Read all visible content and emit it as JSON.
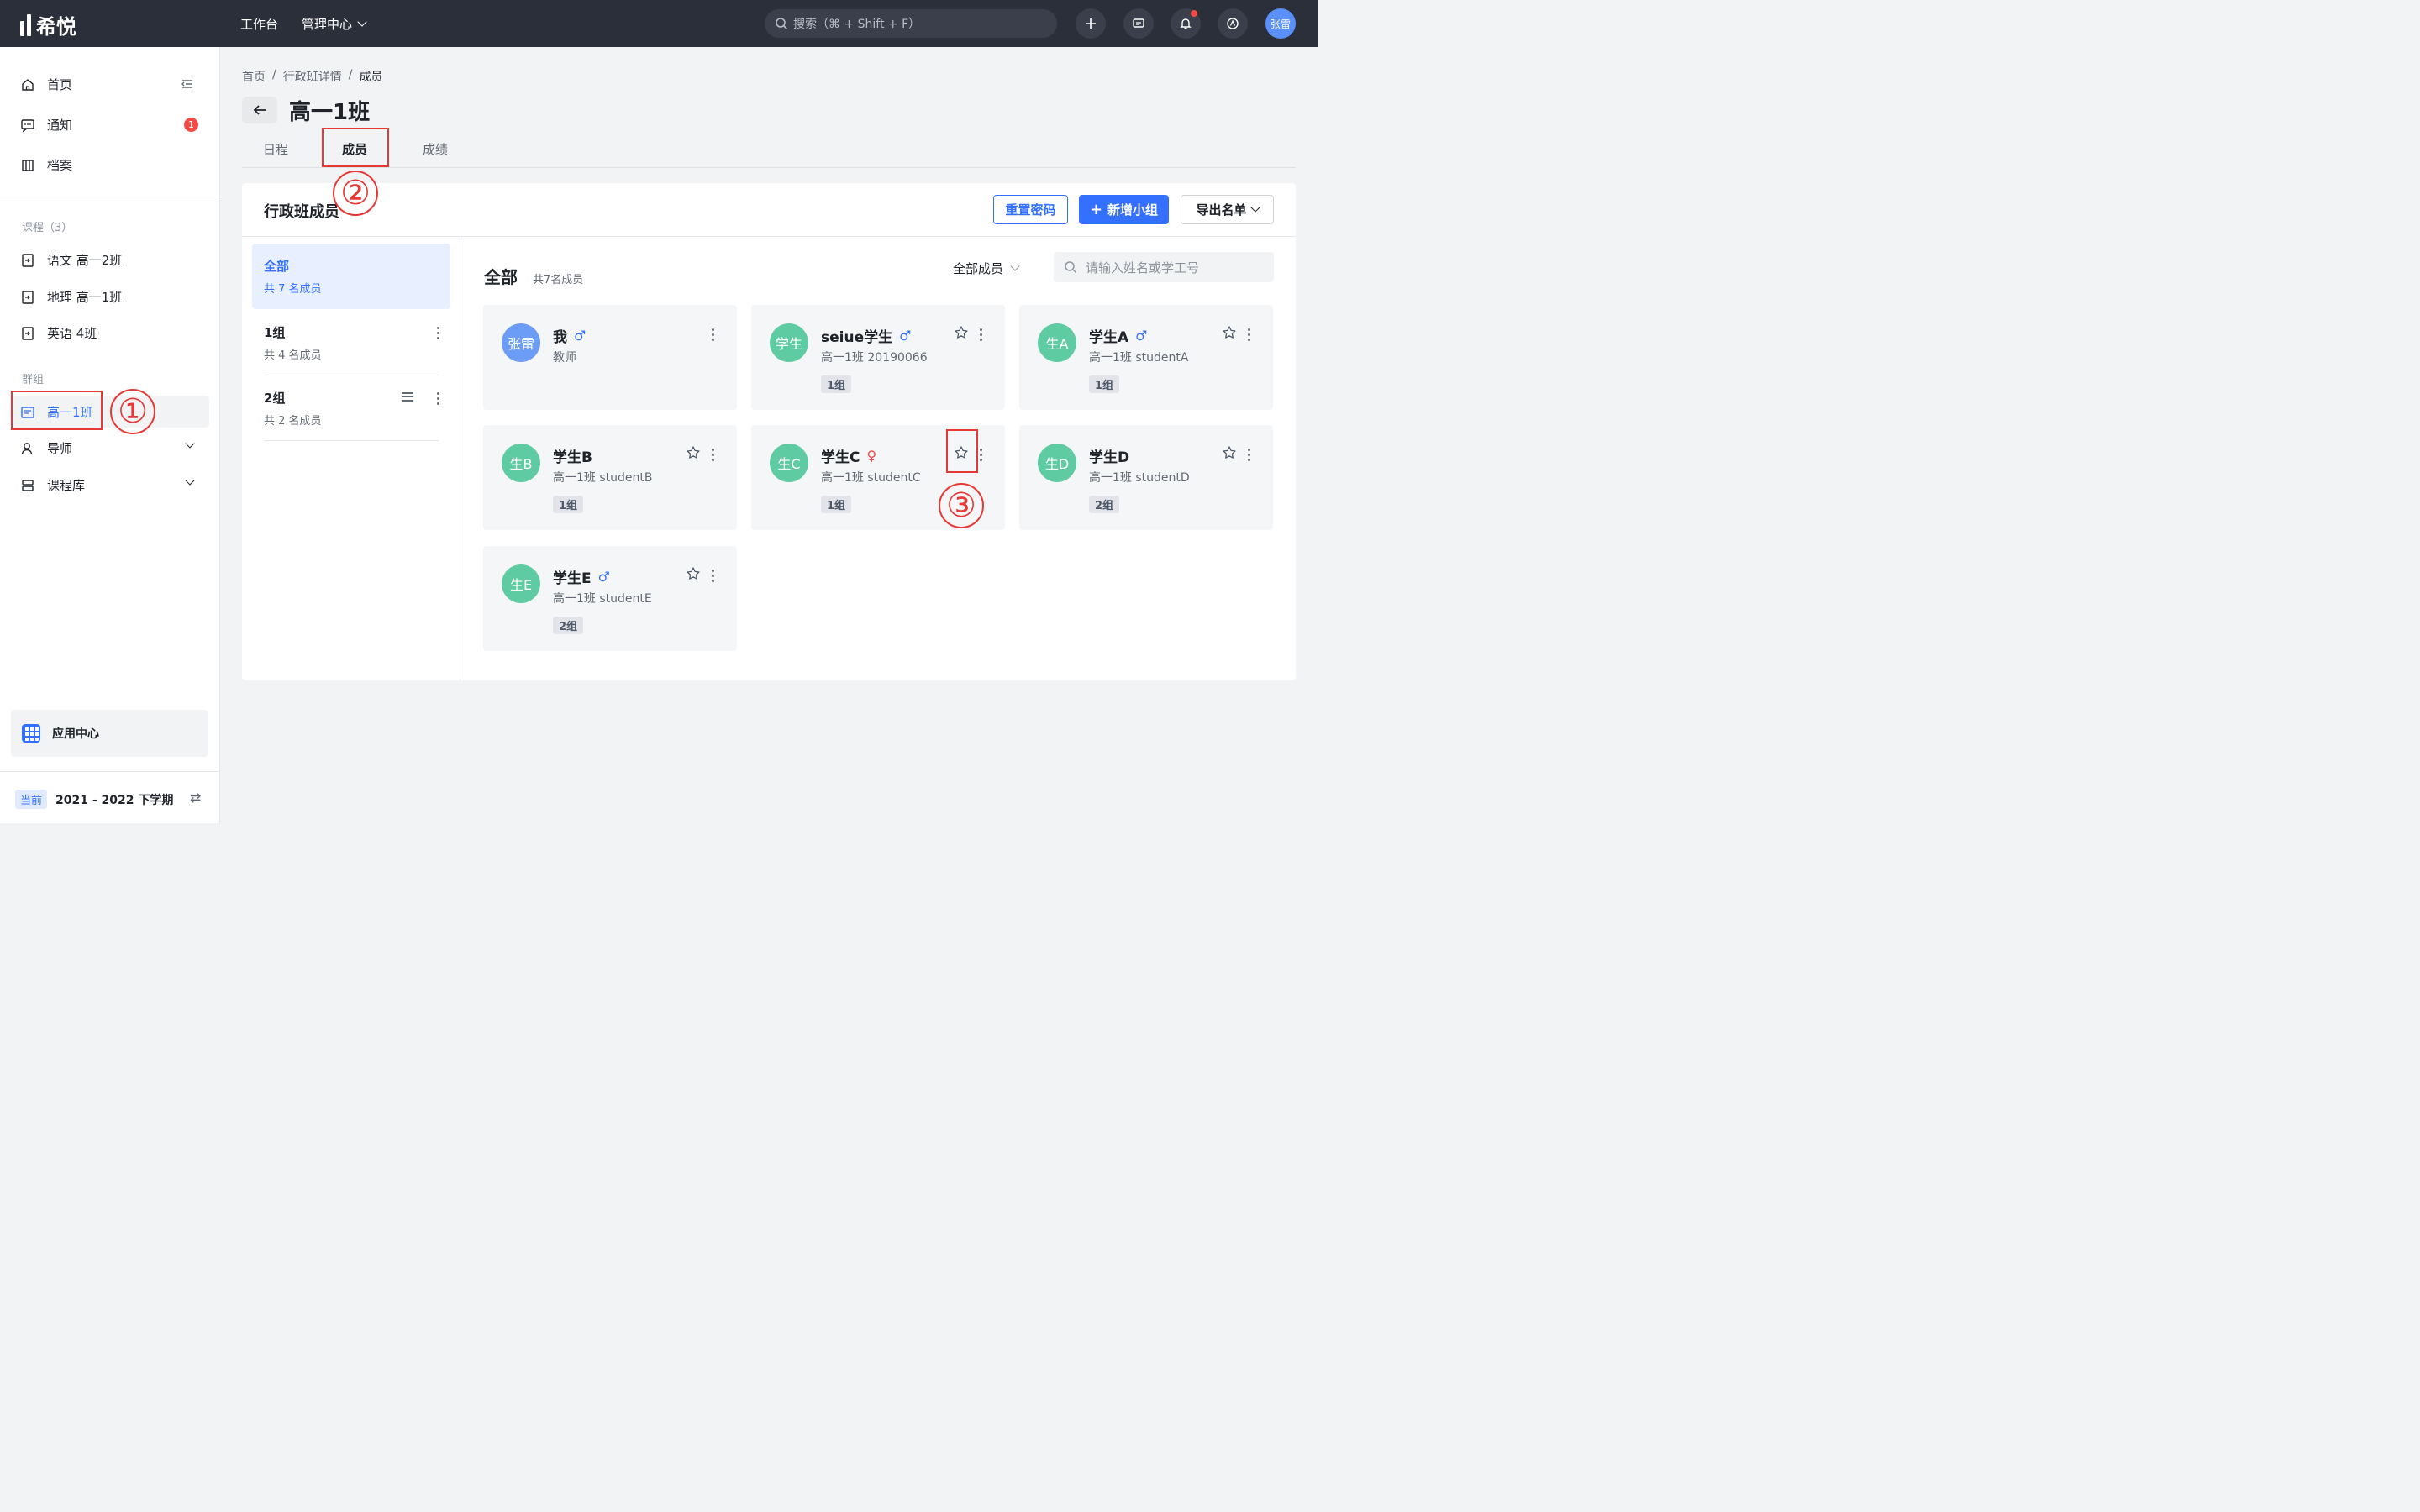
{
  "topbar": {
    "logo": "希悦",
    "nav": [
      "工作台",
      "管理中心"
    ],
    "search_placeholder": "搜索（⌘ + Shift + F）",
    "user_avatar": "张雷"
  },
  "sidebar": {
    "top_items": [
      {
        "label": "首页"
      },
      {
        "label": "通知",
        "badge": "1"
      },
      {
        "label": "档案"
      }
    ],
    "courses_heading": "课程（3）",
    "courses": [
      "语文 高一2班",
      "地理 高一1班",
      "英语 4班"
    ],
    "groups_heading": "群组",
    "group_items": [
      {
        "label": "高一1班",
        "active": true
      },
      {
        "label": "导师"
      },
      {
        "label": "课程库"
      }
    ],
    "app_center": "应用中心",
    "term_tag": "当前",
    "term": "2021 - 2022 下学期"
  },
  "breadcrumb": [
    "首页",
    "/",
    "行政班详情",
    "/",
    "成员"
  ],
  "page_title": "高一1班",
  "tabs": [
    "日程",
    "成员",
    "成绩"
  ],
  "panel": {
    "title": "行政班成员",
    "reset_password": "重置密码",
    "add_group": "新增小组",
    "export": "导出名单"
  },
  "groups": [
    {
      "name": "全部",
      "count": "共 7 名成员"
    },
    {
      "name": "1组",
      "count": "共 4 名成员"
    },
    {
      "name": "2组",
      "count": "共 2 名成员"
    }
  ],
  "members_header": {
    "title": "全部",
    "count": "共7名成员",
    "filter": "全部成员",
    "search_placeholder": "请输入姓名或学工号"
  },
  "members": [
    {
      "avatar": "张雷",
      "name": "我",
      "gender": "♂",
      "sub": "教师",
      "group": "",
      "color": "#6b9cf6"
    },
    {
      "avatar": "学生",
      "name": "seiue学生",
      "gender": "♂",
      "sub": "高一1班 20190066",
      "group": "1组",
      "color": "#5fcba2"
    },
    {
      "avatar": "生A",
      "name": "学生A",
      "gender": "♂",
      "sub": "高一1班 studentA",
      "group": "1组",
      "color": "#5fcba2"
    },
    {
      "avatar": "生B",
      "name": "学生B",
      "gender": "",
      "sub": "高一1班 studentB",
      "group": "1组",
      "color": "#5fcba2"
    },
    {
      "avatar": "生C",
      "name": "学生C",
      "gender": "♀",
      "sub": "高一1班 studentC",
      "group": "1组",
      "color": "#5fcba2"
    },
    {
      "avatar": "生D",
      "name": "学生D",
      "gender": "",
      "sub": "高一1班 studentD",
      "group": "2组",
      "color": "#5fcba2"
    },
    {
      "avatar": "生E",
      "name": "学生E",
      "gender": "♂",
      "sub": "高一1班 studentE",
      "group": "2组",
      "color": "#5fcba2"
    }
  ],
  "annotations": [
    "①",
    "②",
    "③"
  ]
}
